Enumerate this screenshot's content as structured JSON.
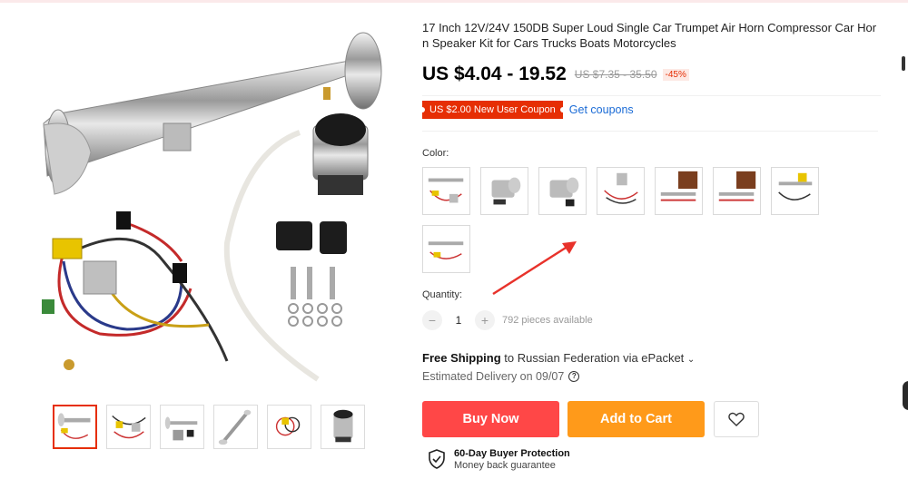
{
  "product": {
    "title": "17 Inch 12V/24V 150DB Super Loud Single Car Trumpet Air Horn Compressor Car Horn Speaker Kit for Cars Trucks Boats Motorcycles",
    "price": "US $4.04 - 19.52",
    "old_price": "US $7.35 - 35.50",
    "discount": "-45%"
  },
  "coupon": {
    "badge": "US $2.00 New User Coupon",
    "link": "Get coupons"
  },
  "color": {
    "label": "Color:",
    "options": [
      "option-1",
      "option-2",
      "option-3",
      "option-4",
      "option-5",
      "option-6",
      "option-7",
      "option-8"
    ]
  },
  "quantity": {
    "label": "Quantity:",
    "minus": "−",
    "value": "1",
    "plus": "+",
    "available": "792 pieces available"
  },
  "shipping": {
    "free": "Free Shipping",
    "destination": " to Russian Federation via ePacket",
    "chevron": "⌄",
    "delivery": "Estimated Delivery on 09/07",
    "help_icon": "?"
  },
  "actions": {
    "buy_now": "Buy Now",
    "add_to_cart": "Add to Cart",
    "wishlist_icon": "heart-icon"
  },
  "protection": {
    "title": "60-Day Buyer Protection",
    "subtitle": "Money back guarantee"
  },
  "gallery": {
    "thumbnail_count": 6,
    "active_thumbnail": 1
  },
  "colors": {
    "price_red": "#e62e04",
    "buy_now": "#ff4747",
    "add_to_cart": "#ff9a1a",
    "link_blue": "#1a6bd6"
  }
}
